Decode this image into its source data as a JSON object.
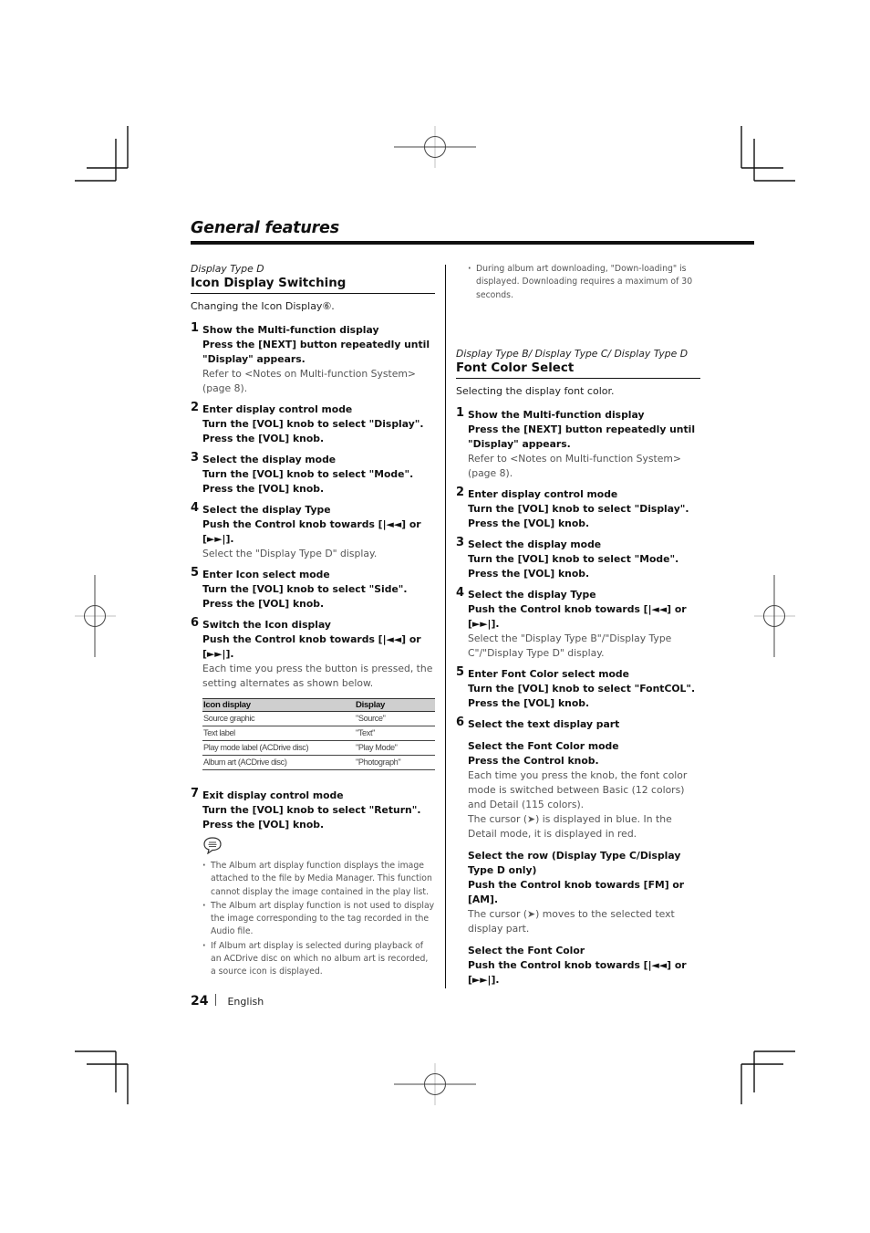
{
  "page": {
    "title": "General features",
    "page_number": "24",
    "language": "English"
  },
  "left": {
    "subtitle": "Display Type D",
    "section_title": "Icon Display Switching",
    "intro": "Changing the Icon Display⑥.",
    "steps": [
      {
        "num": "1",
        "title": "Show the Multi-function display",
        "bold": "Press the [NEXT] button repeatedly until \"Display\" appears.",
        "light": "Refer to <Notes on Multi-function System> (page 8)."
      },
      {
        "num": "2",
        "title": "Enter display control mode",
        "bold": "Turn the [VOL] knob to select \"Display\". Press the [VOL] knob.",
        "light": ""
      },
      {
        "num": "3",
        "title": "Select the display mode",
        "bold": "Turn the [VOL] knob to select \"Mode\". Press the [VOL] knob.",
        "light": ""
      },
      {
        "num": "4",
        "title": "Select the display Type",
        "bold": "Push the Control knob towards [|◄◄] or [►►|].",
        "light": "Select the \"Display Type D\" display."
      },
      {
        "num": "5",
        "title": "Enter Icon select mode",
        "bold": "Turn the [VOL] knob to select \"Side\". Press the [VOL] knob.",
        "light": ""
      },
      {
        "num": "6",
        "title": "Switch the Icon display",
        "bold": "Push the Control knob towards [|◄◄] or [►►|].",
        "light": "Each time you press the button is pressed, the setting alternates as shown below."
      },
      {
        "num": "7",
        "title": "Exit display control mode",
        "bold": "Turn the [VOL] knob to select \"Return\". Press the [VOL] knob.",
        "light": ""
      }
    ],
    "table": {
      "headers": [
        "Icon display",
        "Display"
      ],
      "rows": [
        [
          "Source graphic",
          "\"Source\""
        ],
        [
          "Text label",
          "\"Text\""
        ],
        [
          "Play mode label (ACDrive disc)",
          "\"Play Mode\""
        ],
        [
          "Album art (ACDrive disc)",
          "\"Photograph\""
        ]
      ]
    },
    "note_icon": "note-speech-bubble-icon",
    "notes": [
      "The Album art display function displays the image attached to the file by Media Manager. This function cannot display the image contained in the play list.",
      "The Album art display function is not used to display the image corresponding to the tag recorded in the Audio file.",
      "If Album art display is selected during playback of an ACDrive disc on which no album art is recorded, a source icon is displayed."
    ]
  },
  "right": {
    "top_note": "During album art downloading, \"Down-loading\" is displayed. Downloading requires a maximum of 30 seconds.",
    "subtitle": "Display Type B/ Display Type C/ Display Type D",
    "section_title": "Font Color Select",
    "intro": "Selecting the display font color.",
    "steps": [
      {
        "num": "1",
        "title": "Show the Multi-function display",
        "bold": "Press the [NEXT] button repeatedly until \"Display\" appears.",
        "light": "Refer to <Notes on Multi-function System> (page 8)."
      },
      {
        "num": "2",
        "title": "Enter display control mode",
        "bold": "Turn the [VOL] knob to select \"Display\". Press the [VOL] knob.",
        "light": ""
      },
      {
        "num": "3",
        "title": "Select the display mode",
        "bold": "Turn the [VOL] knob to select \"Mode\". Press the [VOL] knob.",
        "light": ""
      },
      {
        "num": "4",
        "title": "Select the display Type",
        "bold": "Push the Control knob towards [|◄◄] or [►►|].",
        "light": "Select the \"Display Type B\"/\"Display Type C\"/\"Display Type D\" display."
      },
      {
        "num": "5",
        "title": "Enter Font Color select mode",
        "bold": "Turn the [VOL] knob to select \"FontCOL\". Press the [VOL] knob.",
        "light": ""
      },
      {
        "num": "6",
        "title": "Select the text display part",
        "bold": "",
        "light": ""
      }
    ],
    "substeps": [
      {
        "title": "Select the Font Color mode",
        "bold": "Press the Control knob.",
        "light": "Each time you press the knob, the font color mode is switched between Basic (12 colors) and Detail (115 colors).",
        "light2": "The cursor (➤) is displayed in blue. In the Detail mode, it is displayed in red."
      },
      {
        "title": "Select the row (Display Type C/Display Type D only)",
        "bold": "Push the Control knob towards [FM] or [AM].",
        "light": "The cursor (➤) moves to the selected text display part.",
        "light2": ""
      },
      {
        "title": "Select the Font Color",
        "bold": "Push the Control knob towards [|◄◄] or [►►|].",
        "light": "",
        "light2": ""
      }
    ]
  }
}
